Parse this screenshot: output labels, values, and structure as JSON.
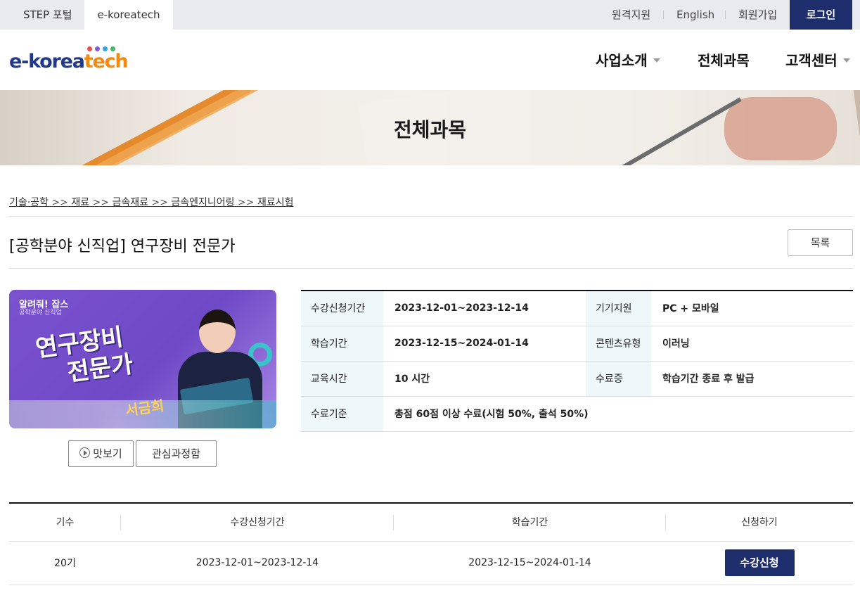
{
  "topbar": {
    "tab_step": "STEP 포털",
    "tab_ek": "e-koreatech",
    "remote_support": "원격지원",
    "english": "English",
    "join": "회원가입",
    "login": "로그인"
  },
  "logo": {
    "part_k": "e-korea",
    "part_t": "tech",
    "dot_colors": [
      "#e24e4e",
      "#7b5cd6",
      "#3aa0d8",
      "#3fb56a"
    ]
  },
  "nav": {
    "item1": "사업소개",
    "item2": "전체과목",
    "item3": "고객센터"
  },
  "banner": {
    "title": "전체과목"
  },
  "breadcrumb": [
    "기술·공학",
    "재료",
    "금속재료",
    "금속엔지니어링",
    "재료시험"
  ],
  "breadcrumb_sep": ">>",
  "course": {
    "title": "[공학분야 신직업] 연구장비 전문가",
    "list_button": "목록"
  },
  "thumbnail": {
    "brand": "알려줘! 잡스",
    "subtitle": "공학분야 신직업",
    "main_line1": "연구장비",
    "main_line2": "전문가",
    "instructor": "서금희"
  },
  "buttons": {
    "preview": "맛보기",
    "interest": "관심과정함"
  },
  "info": {
    "enroll_period_label": "수강신청기간",
    "enroll_period_value": "2023-12-01~2023-12-14",
    "device_label": "기기지원",
    "device_value": "PC + 모바일",
    "study_period_label": "학습기간",
    "study_period_value": "2023-12-15~2024-01-14",
    "content_type_label": "콘텐츠유형",
    "content_type_value": "이러닝",
    "edu_time_label": "교육시간",
    "edu_time_value": "10 시간",
    "certificate_label": "수료증",
    "certificate_value": "학습기간 종료 후 발급",
    "criteria_label": "수료기준",
    "criteria_value": "총점 60점 이상 수료(시험 50%, 출석 50%)"
  },
  "schedule": {
    "headers": [
      "기수",
      "수강신청기간",
      "학습기간",
      "신청하기"
    ],
    "rows": [
      {
        "term": "20기",
        "enroll": "2023-12-01~2023-12-14",
        "study": "2023-12-15~2024-01-14",
        "action": "수강신청"
      }
    ]
  }
}
